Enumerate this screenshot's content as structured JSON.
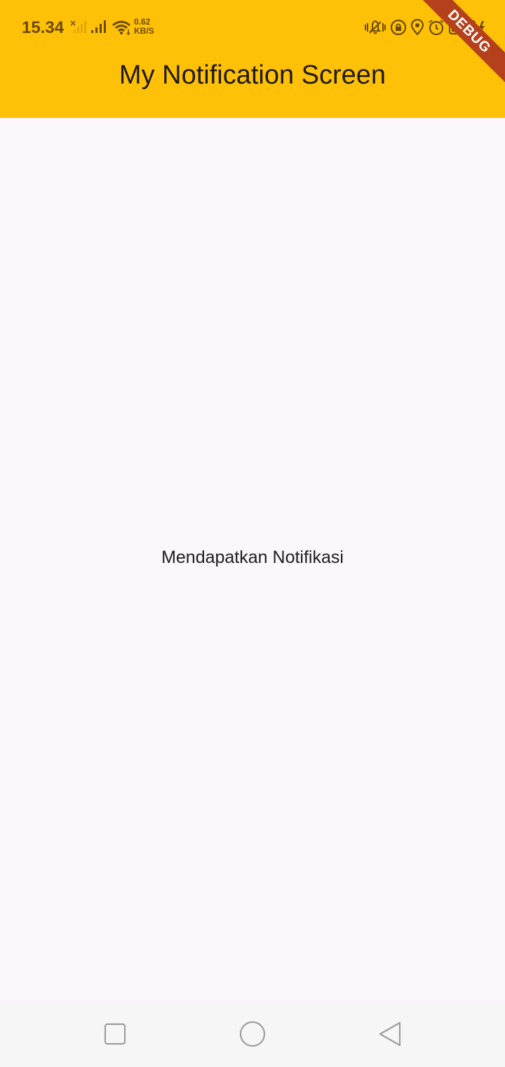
{
  "status_bar": {
    "time": "15.34",
    "net_speed_value": "0.62",
    "net_speed_unit": "KB/S",
    "icons": [
      "sim-no-signal-icon",
      "cellular-signal-icon",
      "wifi-icon",
      "vibrate-icon",
      "orientation-lock-icon",
      "location-icon",
      "alarm-icon",
      "battery-charging-icon"
    ]
  },
  "app_bar": {
    "title": "My Notification Screen",
    "color": "#ffc107"
  },
  "debug_banner": {
    "label": "DEBUG",
    "color": "#b5401c"
  },
  "body": {
    "message": "Mendapatkan Notifikasi",
    "background": "#fcf6fd"
  },
  "nav_bar": {
    "buttons": [
      "recents-icon",
      "home-icon",
      "back-icon"
    ]
  }
}
